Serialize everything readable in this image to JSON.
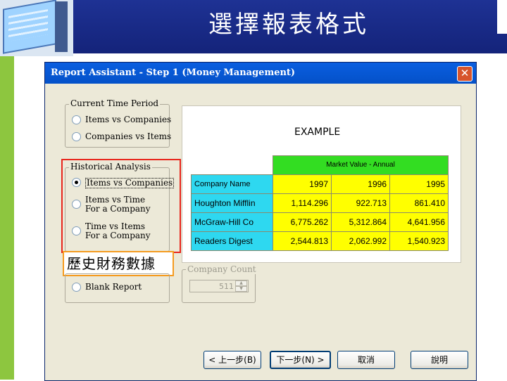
{
  "slide": {
    "title": "選擇報表格式"
  },
  "dialog": {
    "title": "Report Assistant - Step 1    (Money Management)",
    "close_label": "✕",
    "current_time_period": {
      "legend": "Current Time Period",
      "options": [
        "Items vs Companies",
        "Companies vs Items"
      ]
    },
    "historical_analysis": {
      "legend": "Historical Analysis",
      "options": [
        {
          "line1": "Items vs Companies",
          "line2": ""
        },
        {
          "line1": "Items vs Time",
          "line2": "For a Company"
        },
        {
          "line1": "Time vs Items",
          "line2": "For a Company"
        }
      ],
      "selected_index": 0
    },
    "callout": "歷史財務數據",
    "blank_report_label": "Blank Report",
    "company_count": {
      "legend": "Company Count",
      "value": "511"
    },
    "example": {
      "label": "EXAMPLE",
      "header": "Market Value - Annual",
      "column_header": "Company Name",
      "years": [
        "1997",
        "1996",
        "1995"
      ],
      "rows": [
        {
          "name": "Houghton Mifflin",
          "values": [
            "1,114.296",
            "922.713",
            "861.410"
          ]
        },
        {
          "name": "McGraw-Hill Co",
          "values": [
            "6,775.262",
            "5,312.864",
            "4,641.956"
          ]
        },
        {
          "name": "Readers Digest",
          "values": [
            "2,544.813",
            "2,062.992",
            "1,540.923"
          ]
        }
      ]
    },
    "buttons": {
      "back": "< 上一步(B)",
      "next": "下一步(N) >",
      "cancel": "取消",
      "help": "說明"
    }
  }
}
